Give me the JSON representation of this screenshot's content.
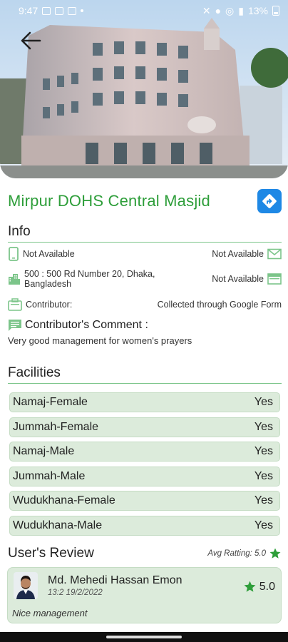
{
  "status_bar": {
    "time": "9:47",
    "battery": "13%"
  },
  "place": {
    "name": "Mirpur DOHS Central Masjid"
  },
  "info": {
    "heading": "Info",
    "phone": "Not Available",
    "email": "Not Available",
    "address": "500 : 500 Rd Number 20, Dhaka, Bangladesh",
    "website": "Not Available",
    "contributor_label": "Contributor:",
    "contributor_value": "Collected through Google Form",
    "comment_heading": "Contributor's Comment :",
    "comment_text": "Very good management for women's prayers"
  },
  "facilities": {
    "heading": "Facilities",
    "items": [
      {
        "name": "Namaj-Female",
        "value": "Yes"
      },
      {
        "name": "Jummah-Female",
        "value": "Yes"
      },
      {
        "name": "Namaj-Male",
        "value": "Yes"
      },
      {
        "name": "Jummah-Male",
        "value": "Yes"
      },
      {
        "name": "Wudukhana-Female",
        "value": "Yes"
      },
      {
        "name": "Wudukhana-Male",
        "value": "Yes"
      }
    ]
  },
  "reviews": {
    "heading": "User's Review",
    "avg_label": "Avg Ratting: 5.0",
    "items": [
      {
        "user": "Md. Mehedi Hassan Emon",
        "time": "13:2 19/2/2022",
        "rating": "5.0",
        "text": "Nice management"
      }
    ]
  },
  "colors": {
    "accent_green": "#2e9e3a",
    "line_green": "#7cc58a",
    "card_bg": "#dcebdb",
    "direction_button": "#1e88e5"
  },
  "icons": [
    "back-arrow-icon",
    "directions-icon",
    "phone-icon",
    "mail-icon",
    "building-icon",
    "web-icon",
    "contributor-icon",
    "comment-icon",
    "star-icon"
  ]
}
